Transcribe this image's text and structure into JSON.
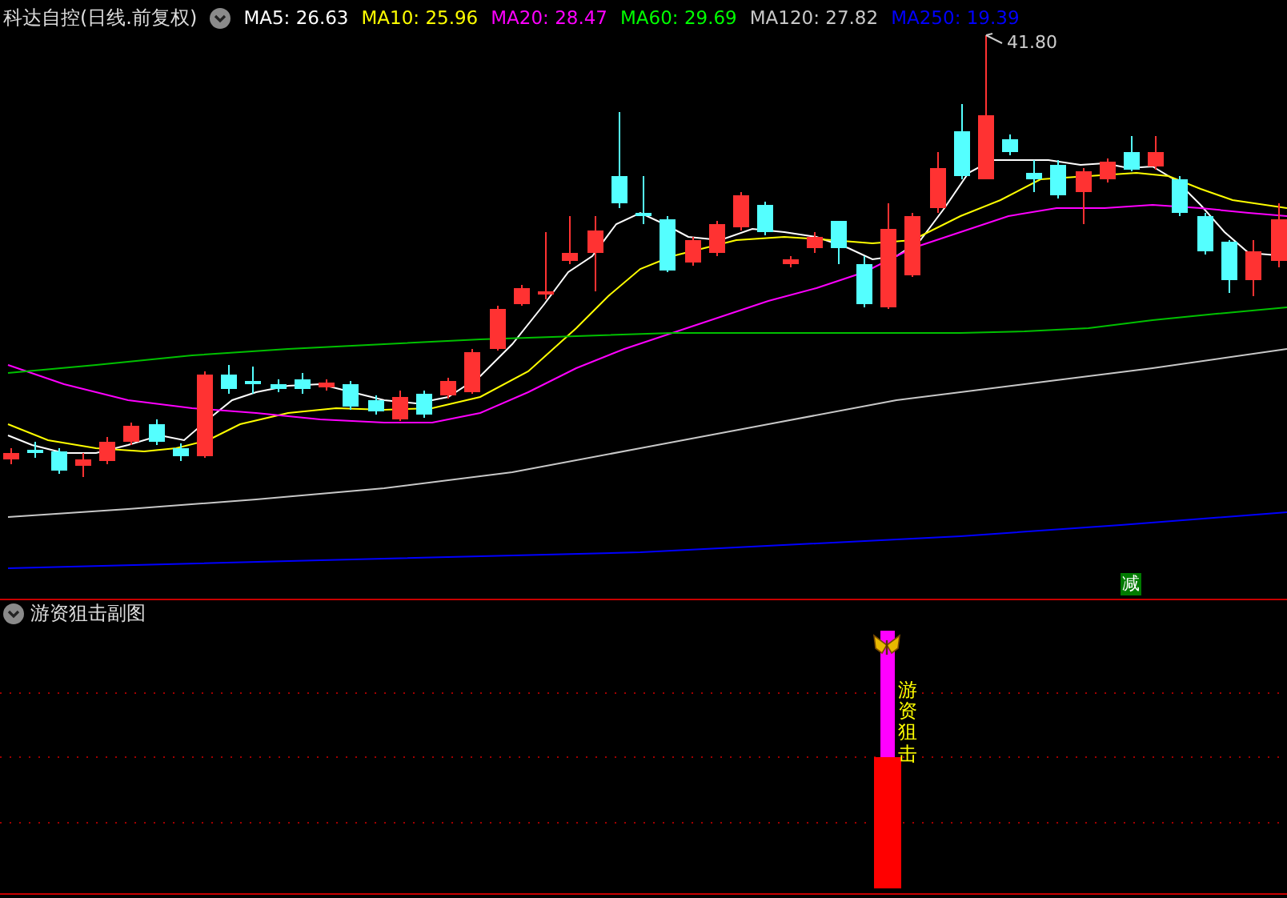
{
  "header": {
    "title": "科达自控(日线.前复权)",
    "indicators": [
      {
        "label": "MA5: 26.63",
        "color": "#ffffff"
      },
      {
        "label": "MA10: 25.96",
        "color": "#ffff00"
      },
      {
        "label": "MA20: 28.47",
        "color": "#ff00ff"
      },
      {
        "label": "MA60: 29.69",
        "color": "#00ff00"
      },
      {
        "label": "MA120: 27.82",
        "color": "#c8c8c8"
      },
      {
        "label": "MA250: 19.39",
        "color": "#0000ff"
      }
    ]
  },
  "price_chart": {
    "high_marker": "41.80",
    "signal_badge": "减"
  },
  "sub_chart": {
    "title": "游资狙击副图",
    "signal_label": "游资狙击"
  }
}
